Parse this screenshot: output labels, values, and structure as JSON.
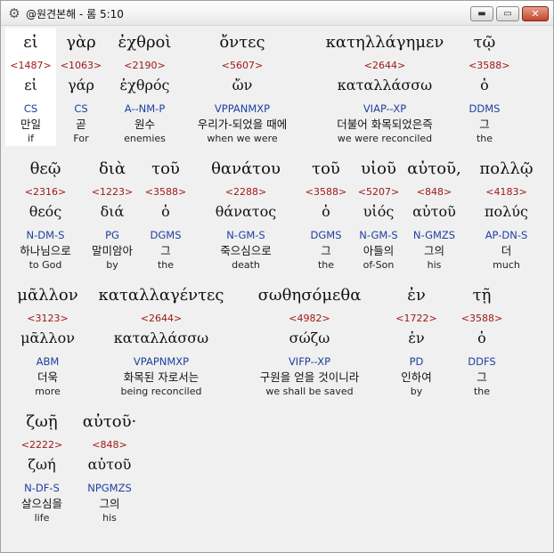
{
  "window": {
    "title": "@원견본해 - 롬 5:10",
    "app_icon": "settings-gear-icon",
    "buttons": {
      "minimize": "▬",
      "maximize": "▭",
      "close": "✕"
    }
  },
  "rows": [
    {
      "words": [
        {
          "greek": "εἰ",
          "strong": "<1487>",
          "lemma": "εἰ",
          "parse": "CS",
          "korean": "만일",
          "english": "if",
          "selected": true
        },
        {
          "greek": "γὰρ",
          "strong": "<1063>",
          "lemma": "γάρ",
          "parse": "CS",
          "korean": "곧",
          "english": "For"
        },
        {
          "greek": "ἐχθροὶ",
          "strong": "<2190>",
          "lemma": "ἐχθρός",
          "parse": "A--NM-P",
          "korean": "원수",
          "english": "enemies"
        },
        {
          "greek": "ὄντες",
          "strong": "<5607>",
          "lemma": "ὤν",
          "parse": "VPPANMXP",
          "korean": "우리가-되었을 때에",
          "english": "when we were"
        },
        {
          "greek": "κατηλλάγημεν",
          "strong": "<2644>",
          "lemma": "καταλλάσσω",
          "parse": "VIAP--XP",
          "korean": "더불어 화목되었은즉",
          "english": "we were reconciled"
        },
        {
          "greek": "τῷ",
          "strong": "<3588>",
          "lemma": "ὁ",
          "parse": "DDMS",
          "korean": "그",
          "english": "the"
        }
      ]
    },
    {
      "words": [
        {
          "greek": "θεῷ",
          "strong": "<2316>",
          "lemma": "θεός",
          "parse": "N-DM-S",
          "korean": "하나님으로",
          "english": "to God"
        },
        {
          "greek": "διὰ",
          "strong": "<1223>",
          "lemma": "διά",
          "parse": "PG",
          "korean": "말미암아",
          "english": "by"
        },
        {
          "greek": "τοῦ",
          "strong": "<3588>",
          "lemma": "ὁ",
          "parse": "DGMS",
          "korean": "그",
          "english": "the"
        },
        {
          "greek": "θανάτου",
          "strong": "<2288>",
          "lemma": "θάνατος",
          "parse": "N-GM-S",
          "korean": "죽으심으로",
          "english": "death"
        },
        {
          "greek": "τοῦ",
          "strong": "<3588>",
          "lemma": "ὁ",
          "parse": "DGMS",
          "korean": "그",
          "english": "the"
        },
        {
          "greek": "υἱοῦ",
          "strong": "<5207>",
          "lemma": "υἱός",
          "parse": "N-GM-S",
          "korean": "아들의",
          "english": "of-Son"
        },
        {
          "greek": "αὐτοῦ,",
          "strong": "<848>",
          "lemma": "αὐτοῦ",
          "parse": "N-GMZS",
          "korean": "그의",
          "english": "his"
        },
        {
          "greek": "πολλῷ",
          "strong": "<4183>",
          "lemma": "πολύς",
          "parse": "AP-DN-S",
          "korean": "더",
          "english": "much"
        }
      ]
    },
    {
      "words": [
        {
          "greek": "μᾶλλον",
          "strong": "<3123>",
          "lemma": "μᾶλλον",
          "parse": "ABM",
          "korean": "더욱",
          "english": "more"
        },
        {
          "greek": "καταλλαγέντες",
          "strong": "<2644>",
          "lemma": "καταλλάσσω",
          "parse": "VPAPNMXP",
          "korean": "화목된 자로서는",
          "english": "being reconciled"
        },
        {
          "greek": "σωθησόμεθα",
          "strong": "<4982>",
          "lemma": "σώζω",
          "parse": "VIFP--XP",
          "korean": "구원을 얻을 것이니라",
          "english": "we shall be saved"
        },
        {
          "greek": "ἐν",
          "strong": "<1722>",
          "lemma": "ἐν",
          "parse": "PD",
          "korean": "인하여",
          "english": "by"
        },
        {
          "greek": "τῇ",
          "strong": "<3588>",
          "lemma": "ὁ",
          "parse": "DDFS",
          "korean": "그",
          "english": "the"
        }
      ]
    },
    {
      "words": [
        {
          "greek": "ζωῇ",
          "strong": "<2222>",
          "lemma": "ζωή",
          "parse": "N-DF-S",
          "korean": "살으심을",
          "english": "life"
        },
        {
          "greek": "αὐτοῦ·",
          "strong": "<848>",
          "lemma": "αὐτοῦ",
          "parse": "NPGMZS",
          "korean": "그의",
          "english": "his"
        }
      ]
    }
  ],
  "colors": {
    "strong": "#a01818",
    "parse": "#1f3fa0",
    "text": "#111111",
    "background": "#f0f0f0",
    "selected_background": "#ffffff"
  }
}
